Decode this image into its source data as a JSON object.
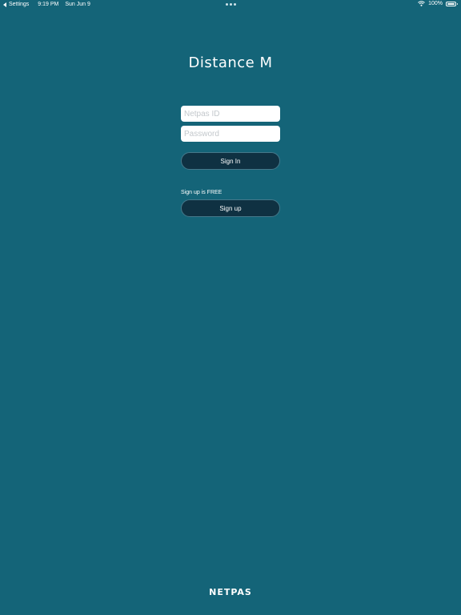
{
  "status_bar": {
    "back_label": "Settings",
    "time": "9:19 PM",
    "date": "Sun Jun 9",
    "battery": "100%",
    "battery_level": 1.0,
    "icons": [
      "back-arrow-icon",
      "wifi-icon",
      "battery-icon",
      "multitasking-dots-icon"
    ]
  },
  "app": {
    "title": "Distance M"
  },
  "login": {
    "id_placeholder": "Netpas ID",
    "password_placeholder": "Password",
    "signin_label": "Sign In"
  },
  "signup": {
    "note": "Sign up is FREE",
    "button_label": "Sign up"
  },
  "footer": {
    "logo": "NETPAS"
  },
  "colors": {
    "background": "#146478",
    "button": "#0f3142",
    "field": "#ffffff"
  }
}
